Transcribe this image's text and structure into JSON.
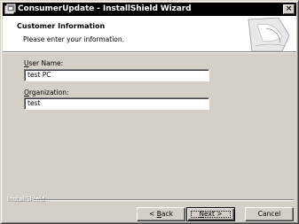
{
  "window": {
    "title": "ConsumerUpdate - InstallShield Wizard",
    "close_glyph": "×"
  },
  "header": {
    "title": "Customer Information",
    "subtitle": "Please enter your information."
  },
  "form": {
    "user_name_label_accel": "U",
    "user_name_label_rest": "ser Name:",
    "user_name_value": "test PC",
    "organization_label_accel": "O",
    "organization_label_rest": "rganization:",
    "organization_value": "test"
  },
  "footer": {
    "brand": "InstallShield"
  },
  "buttons": {
    "back_prefix": "< ",
    "back_accel": "B",
    "back_rest": "ack",
    "next_accel": "N",
    "next_rest": "ext >",
    "cancel_label": "Cancel"
  },
  "colors": {
    "titlebar": "#000000",
    "dialog_face": "#d4d0c8",
    "header_bg": "#ffffff"
  },
  "icons": [
    "app-icon",
    "close-icon",
    "header-graphic"
  ]
}
